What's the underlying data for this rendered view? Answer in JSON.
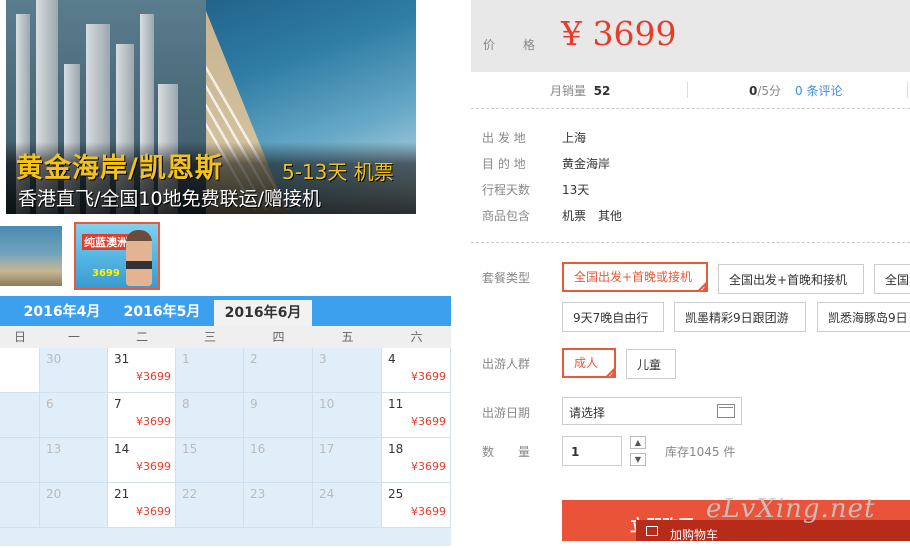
{
  "hero": {
    "title": "黄金海岸/凯恩斯",
    "title_suffix": "5-13天 机票",
    "subtitle": "香港直飞/全国10地免费联运/赠接机"
  },
  "thumbnails": [
    {
      "name": "gold-coast-thumb"
    },
    {
      "name": "pure-blue-australia-thumb",
      "text": "纯蓝澳洲",
      "price": "3699"
    }
  ],
  "calendar": {
    "months": [
      "2016年4月",
      "2016年5月",
      "2016年6月"
    ],
    "active_month": "2016年6月",
    "weekdays": [
      "日",
      "一",
      "二",
      "三",
      "四",
      "五",
      "六"
    ],
    "rows": [
      [
        {
          "d": ""
        },
        {
          "d": "30"
        },
        {
          "d": "31",
          "p": "¥3699"
        },
        {
          "d": "1"
        },
        {
          "d": "2"
        },
        {
          "d": "3"
        },
        {
          "d": "4",
          "p": "¥3699"
        }
      ],
      [
        {
          "d": ""
        },
        {
          "d": "6"
        },
        {
          "d": "7",
          "p": "¥3699"
        },
        {
          "d": "8"
        },
        {
          "d": "9"
        },
        {
          "d": "10"
        },
        {
          "d": "11",
          "p": "¥3699"
        }
      ],
      [
        {
          "d": ""
        },
        {
          "d": "13"
        },
        {
          "d": "14",
          "p": "¥3699"
        },
        {
          "d": "15"
        },
        {
          "d": "16"
        },
        {
          "d": "17"
        },
        {
          "d": "18",
          "p": "¥3699"
        }
      ],
      [
        {
          "d": ""
        },
        {
          "d": "20"
        },
        {
          "d": "21",
          "p": "¥3699"
        },
        {
          "d": "22"
        },
        {
          "d": "23"
        },
        {
          "d": "24"
        },
        {
          "d": "25",
          "p": "¥3699"
        }
      ]
    ]
  },
  "price": {
    "label": "价　格",
    "value": "¥ 3699"
  },
  "stats": {
    "sales_label": "月销量",
    "sales_value": "52",
    "rating_value": "0",
    "rating_suffix": "/5分",
    "comments": "0 条评论"
  },
  "info": [
    {
      "label": "出 发 地",
      "value": "上海"
    },
    {
      "label": "目 的 地",
      "value": "黄金海岸"
    },
    {
      "label": "行程天数",
      "value": "13天"
    },
    {
      "label": "商品包含",
      "value": "机票　其他"
    }
  ],
  "package": {
    "label": "套餐类型",
    "options": [
      "全国出发+首晚或接机",
      "全国出发+首晚和接机",
      "全国",
      "9天7晚自由行",
      "凯墨精彩9日跟团游",
      "凯悉海豚岛9日"
    ],
    "selected": 0
  },
  "group": {
    "label": "出游人群",
    "options": [
      "成人",
      "儿童"
    ],
    "selected": 0
  },
  "date": {
    "label": "出游日期",
    "placeholder": "请选择"
  },
  "quantity": {
    "label": "数　　量",
    "value": "1",
    "stock": "库存1045 件"
  },
  "buttons": {
    "buy": "立即购买",
    "cart": "加购物车"
  },
  "watermark": "eLvXing.net",
  "colors": {
    "accent": "#e85a3c",
    "price": "#e83c2b",
    "calendar_blue": "#3ca0ee"
  }
}
